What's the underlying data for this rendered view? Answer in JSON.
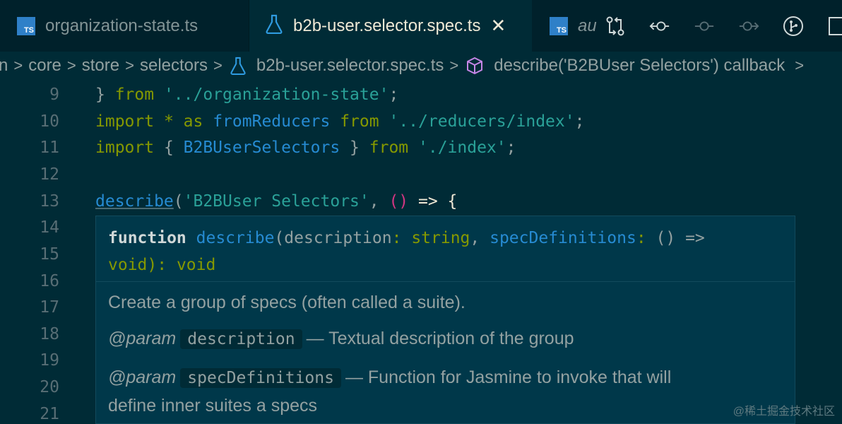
{
  "tabs": [
    {
      "label": "organization-state.ts",
      "icon": "typescript-icon",
      "active": false
    },
    {
      "label": "b2b-user.selector.spec.ts",
      "icon": "flask-icon",
      "active": true
    },
    {
      "label": "au",
      "icon": "typescript-icon",
      "active": false
    }
  ],
  "tab_icon_text": "TS",
  "tab_close_glyph": "✕",
  "toolbar": [
    "compare-changes-icon",
    "go-back-icon",
    "go-to-previous-change-icon",
    "go-to-next-change-icon",
    "git-graph-icon",
    "split-editor-icon"
  ],
  "breadcrumb": {
    "items": [
      "n",
      "core",
      "store",
      "selectors",
      "b2b-user.selector.spec.ts",
      "describe('B2BUser Selectors') callback"
    ],
    "separator": ">"
  },
  "editor": {
    "line_numbers": [
      "9",
      "10",
      "11",
      "12",
      "13",
      "14",
      "15",
      "16",
      "17",
      "18",
      "19",
      "20",
      "21"
    ],
    "lines": {
      "l9": {
        "brace": "} ",
        "from": "from",
        "path": "'../organization-state'",
        "semi": ";"
      },
      "l10": {
        "import": "import",
        "star": " * ",
        "as": "as",
        "name": "fromReducers",
        "from": "from",
        "path": "'../reducers/index'",
        "semi": ";"
      },
      "l11": {
        "import": "import",
        "open": " { ",
        "name": "B2BUserSelectors",
        "close": " } ",
        "from": "from",
        "path": "'./index'",
        "semi": ";"
      },
      "l13": {
        "fn": "describe",
        "open": "(",
        "str": "'B2BUser Selectors'",
        "comma": ", ",
        "parens": "()",
        "arrow": " => ",
        "brace": "{"
      }
    }
  },
  "hover": {
    "signature": {
      "keyword": "function",
      "name": "describe",
      "open": "(",
      "param1": "description",
      "colon1": ": ",
      "type1": "string",
      "comma": ", ",
      "param2": "specDefinitions",
      "colon2": ": ",
      "type2a": "() =>",
      "type2b": "void",
      "close": "): ",
      "ret": "void"
    },
    "description": "Create a group of specs (often called a suite).",
    "params": [
      {
        "tag": "@param",
        "name": "description",
        "text": "— Textual description of the group"
      },
      {
        "tag": "@param",
        "name": "specDefinitions",
        "text": "— Function for Jasmine to invoke that will",
        "text2": "define inner suites a specs"
      }
    ]
  },
  "watermark": "@稀土掘金技术社区",
  "colors": {
    "background": "#002b36",
    "keyword": "#859900",
    "string": "#2aa198",
    "identifier": "#268bd2",
    "hover_bg": "#00384a"
  }
}
